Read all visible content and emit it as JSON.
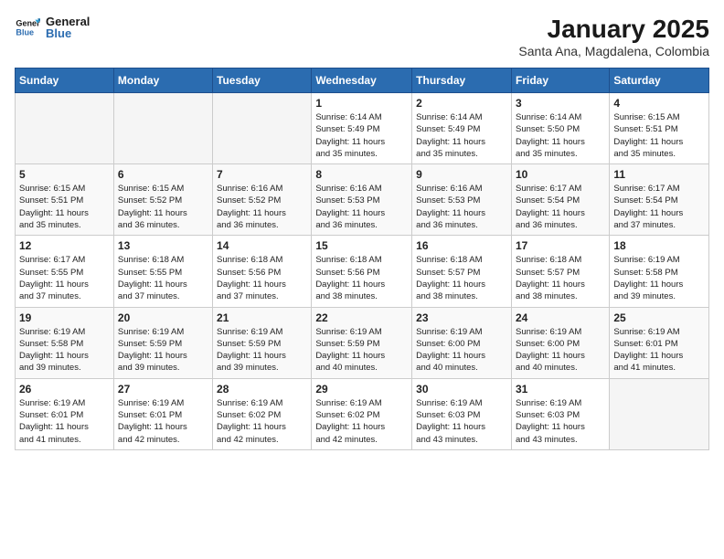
{
  "header": {
    "logo_line1": "General",
    "logo_line2": "Blue",
    "title": "January 2025",
    "subtitle": "Santa Ana, Magdalena, Colombia"
  },
  "days_of_week": [
    "Sunday",
    "Monday",
    "Tuesday",
    "Wednesday",
    "Thursday",
    "Friday",
    "Saturday"
  ],
  "weeks": [
    [
      {
        "num": "",
        "info": ""
      },
      {
        "num": "",
        "info": ""
      },
      {
        "num": "",
        "info": ""
      },
      {
        "num": "1",
        "info": "Sunrise: 6:14 AM\nSunset: 5:49 PM\nDaylight: 11 hours\nand 35 minutes."
      },
      {
        "num": "2",
        "info": "Sunrise: 6:14 AM\nSunset: 5:49 PM\nDaylight: 11 hours\nand 35 minutes."
      },
      {
        "num": "3",
        "info": "Sunrise: 6:14 AM\nSunset: 5:50 PM\nDaylight: 11 hours\nand 35 minutes."
      },
      {
        "num": "4",
        "info": "Sunrise: 6:15 AM\nSunset: 5:51 PM\nDaylight: 11 hours\nand 35 minutes."
      }
    ],
    [
      {
        "num": "5",
        "info": "Sunrise: 6:15 AM\nSunset: 5:51 PM\nDaylight: 11 hours\nand 35 minutes."
      },
      {
        "num": "6",
        "info": "Sunrise: 6:15 AM\nSunset: 5:52 PM\nDaylight: 11 hours\nand 36 minutes."
      },
      {
        "num": "7",
        "info": "Sunrise: 6:16 AM\nSunset: 5:52 PM\nDaylight: 11 hours\nand 36 minutes."
      },
      {
        "num": "8",
        "info": "Sunrise: 6:16 AM\nSunset: 5:53 PM\nDaylight: 11 hours\nand 36 minutes."
      },
      {
        "num": "9",
        "info": "Sunrise: 6:16 AM\nSunset: 5:53 PM\nDaylight: 11 hours\nand 36 minutes."
      },
      {
        "num": "10",
        "info": "Sunrise: 6:17 AM\nSunset: 5:54 PM\nDaylight: 11 hours\nand 36 minutes."
      },
      {
        "num": "11",
        "info": "Sunrise: 6:17 AM\nSunset: 5:54 PM\nDaylight: 11 hours\nand 37 minutes."
      }
    ],
    [
      {
        "num": "12",
        "info": "Sunrise: 6:17 AM\nSunset: 5:55 PM\nDaylight: 11 hours\nand 37 minutes."
      },
      {
        "num": "13",
        "info": "Sunrise: 6:18 AM\nSunset: 5:55 PM\nDaylight: 11 hours\nand 37 minutes."
      },
      {
        "num": "14",
        "info": "Sunrise: 6:18 AM\nSunset: 5:56 PM\nDaylight: 11 hours\nand 37 minutes."
      },
      {
        "num": "15",
        "info": "Sunrise: 6:18 AM\nSunset: 5:56 PM\nDaylight: 11 hours\nand 38 minutes."
      },
      {
        "num": "16",
        "info": "Sunrise: 6:18 AM\nSunset: 5:57 PM\nDaylight: 11 hours\nand 38 minutes."
      },
      {
        "num": "17",
        "info": "Sunrise: 6:18 AM\nSunset: 5:57 PM\nDaylight: 11 hours\nand 38 minutes."
      },
      {
        "num": "18",
        "info": "Sunrise: 6:19 AM\nSunset: 5:58 PM\nDaylight: 11 hours\nand 39 minutes."
      }
    ],
    [
      {
        "num": "19",
        "info": "Sunrise: 6:19 AM\nSunset: 5:58 PM\nDaylight: 11 hours\nand 39 minutes."
      },
      {
        "num": "20",
        "info": "Sunrise: 6:19 AM\nSunset: 5:59 PM\nDaylight: 11 hours\nand 39 minutes."
      },
      {
        "num": "21",
        "info": "Sunrise: 6:19 AM\nSunset: 5:59 PM\nDaylight: 11 hours\nand 39 minutes."
      },
      {
        "num": "22",
        "info": "Sunrise: 6:19 AM\nSunset: 5:59 PM\nDaylight: 11 hours\nand 40 minutes."
      },
      {
        "num": "23",
        "info": "Sunrise: 6:19 AM\nSunset: 6:00 PM\nDaylight: 11 hours\nand 40 minutes."
      },
      {
        "num": "24",
        "info": "Sunrise: 6:19 AM\nSunset: 6:00 PM\nDaylight: 11 hours\nand 40 minutes."
      },
      {
        "num": "25",
        "info": "Sunrise: 6:19 AM\nSunset: 6:01 PM\nDaylight: 11 hours\nand 41 minutes."
      }
    ],
    [
      {
        "num": "26",
        "info": "Sunrise: 6:19 AM\nSunset: 6:01 PM\nDaylight: 11 hours\nand 41 minutes."
      },
      {
        "num": "27",
        "info": "Sunrise: 6:19 AM\nSunset: 6:01 PM\nDaylight: 11 hours\nand 42 minutes."
      },
      {
        "num": "28",
        "info": "Sunrise: 6:19 AM\nSunset: 6:02 PM\nDaylight: 11 hours\nand 42 minutes."
      },
      {
        "num": "29",
        "info": "Sunrise: 6:19 AM\nSunset: 6:02 PM\nDaylight: 11 hours\nand 42 minutes."
      },
      {
        "num": "30",
        "info": "Sunrise: 6:19 AM\nSunset: 6:03 PM\nDaylight: 11 hours\nand 43 minutes."
      },
      {
        "num": "31",
        "info": "Sunrise: 6:19 AM\nSunset: 6:03 PM\nDaylight: 11 hours\nand 43 minutes."
      },
      {
        "num": "",
        "info": ""
      }
    ]
  ]
}
